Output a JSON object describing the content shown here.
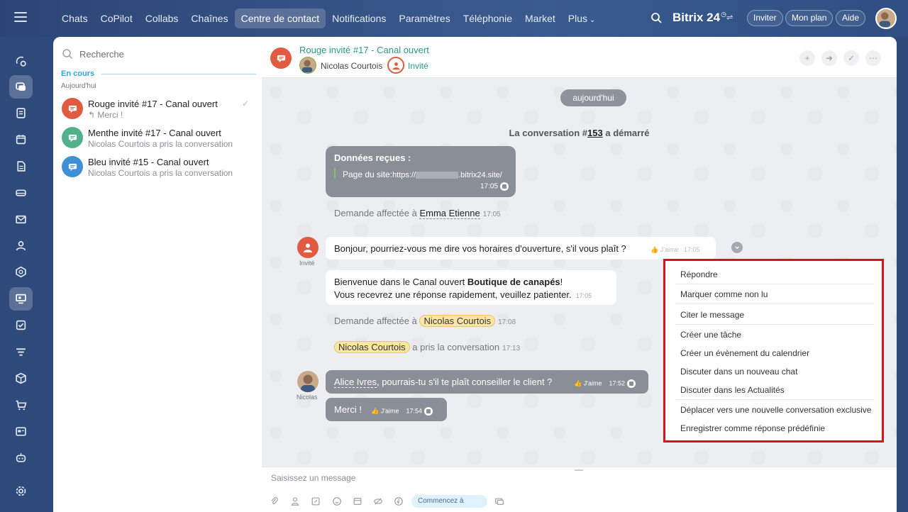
{
  "topbar": {
    "nav": [
      "Chats",
      "CoPilot",
      "Collabs",
      "Chaînes",
      "Centre de contact",
      "Notifications",
      "Paramètres",
      "Téléphonie",
      "Market",
      "Plus"
    ],
    "active_index": 4,
    "brand": "Bitrix 24",
    "buttons": [
      "Inviter",
      "Mon plan",
      "Aide"
    ]
  },
  "rail": {
    "icons": [
      "feed-icon",
      "chat-icon",
      "tasks-board-icon",
      "calendar-icon",
      "document-icon",
      "drive-icon",
      "mail-icon",
      "contacts-icon",
      "hexagon-icon",
      "presentation-icon",
      "checklist-icon",
      "filter-icon",
      "box-icon",
      "cart-icon",
      "card-icon",
      "robot-icon",
      "settings-icon"
    ]
  },
  "list": {
    "search_placeholder": "Recherche",
    "section": "En cours",
    "day": "Aujourd'hui",
    "items": [
      {
        "title": "Rouge invité #17 - Canal ouvert",
        "sub": "Merci !",
        "color": "#e05b3f"
      },
      {
        "title": "Menthe invité #17 - Canal ouvert",
        "sub": "Nicolas Courtois a pris la conversation",
        "color": "#52b08a"
      },
      {
        "title": "Bleu invité #15 - Canal ouvert",
        "sub": "Nicolas Courtois a pris la conversation",
        "color": "#3f8fd8"
      }
    ]
  },
  "chat": {
    "title": "Rouge invité #17 - Canal ouvert",
    "member1": "Nicolas Courtois",
    "member2": "Invité",
    "day_pill": "aujourd'hui",
    "conv_prefix": "La conversation #",
    "conv_number": "153",
    "conv_suffix": " a démarré",
    "data_title": "Données reçues :",
    "data_label": "Page du site:",
    "data_url_a": "https://",
    "data_url_b": ".bitrix24.site/",
    "data_time": "17:05",
    "assign1_prefix": "Demande affectée à ",
    "assign1_name": "Emma Etienne",
    "assign1_time": "17:05",
    "guest_label": "Invité",
    "msg1": "Bonjour, pourriez-vous me dire vos horaires d'ouverture, s'il vous plaît ?",
    "like": "J'aime",
    "msg1_time": "17:05",
    "msg2_a": "Bienvenue dans le Canal ouvert ",
    "msg2_b": "Boutique de canapés",
    "msg2_c": "!",
    "msg2_l2": "Vous recevrez une réponse rapidement, veuillez patienter.",
    "msg2_time": "17:05",
    "assign2_prefix": "Demande affectée à ",
    "assign2_name": "Nicolas Courtois",
    "assign2_time": "17:08",
    "took_name": "Nicolas Courtois",
    "took_text": " a pris la conversation",
    "took_time": "17:13",
    "nicolas_label": "Nicolas",
    "msg3_mention": "Alice Ivres",
    "msg3_text": ", pourrais-tu s'il te plaît conseiller le client ?",
    "msg3_time": "17:52",
    "msg4": "Merci !",
    "msg4_time": "17:54"
  },
  "menu": {
    "items": [
      "Répondre",
      "Marquer comme non lu",
      "Citer le message",
      "Créer une tâche",
      "Créer un évènement du calendrier",
      "Discuter dans un nouveau chat",
      "Discuter dans les Actualités",
      "Déplacer vers une nouvelle conversation exclusive",
      "Enregistrer comme réponse prédéfinie"
    ]
  },
  "input": {
    "placeholder": "Saisissez un message",
    "start_label": "Commencez à"
  }
}
